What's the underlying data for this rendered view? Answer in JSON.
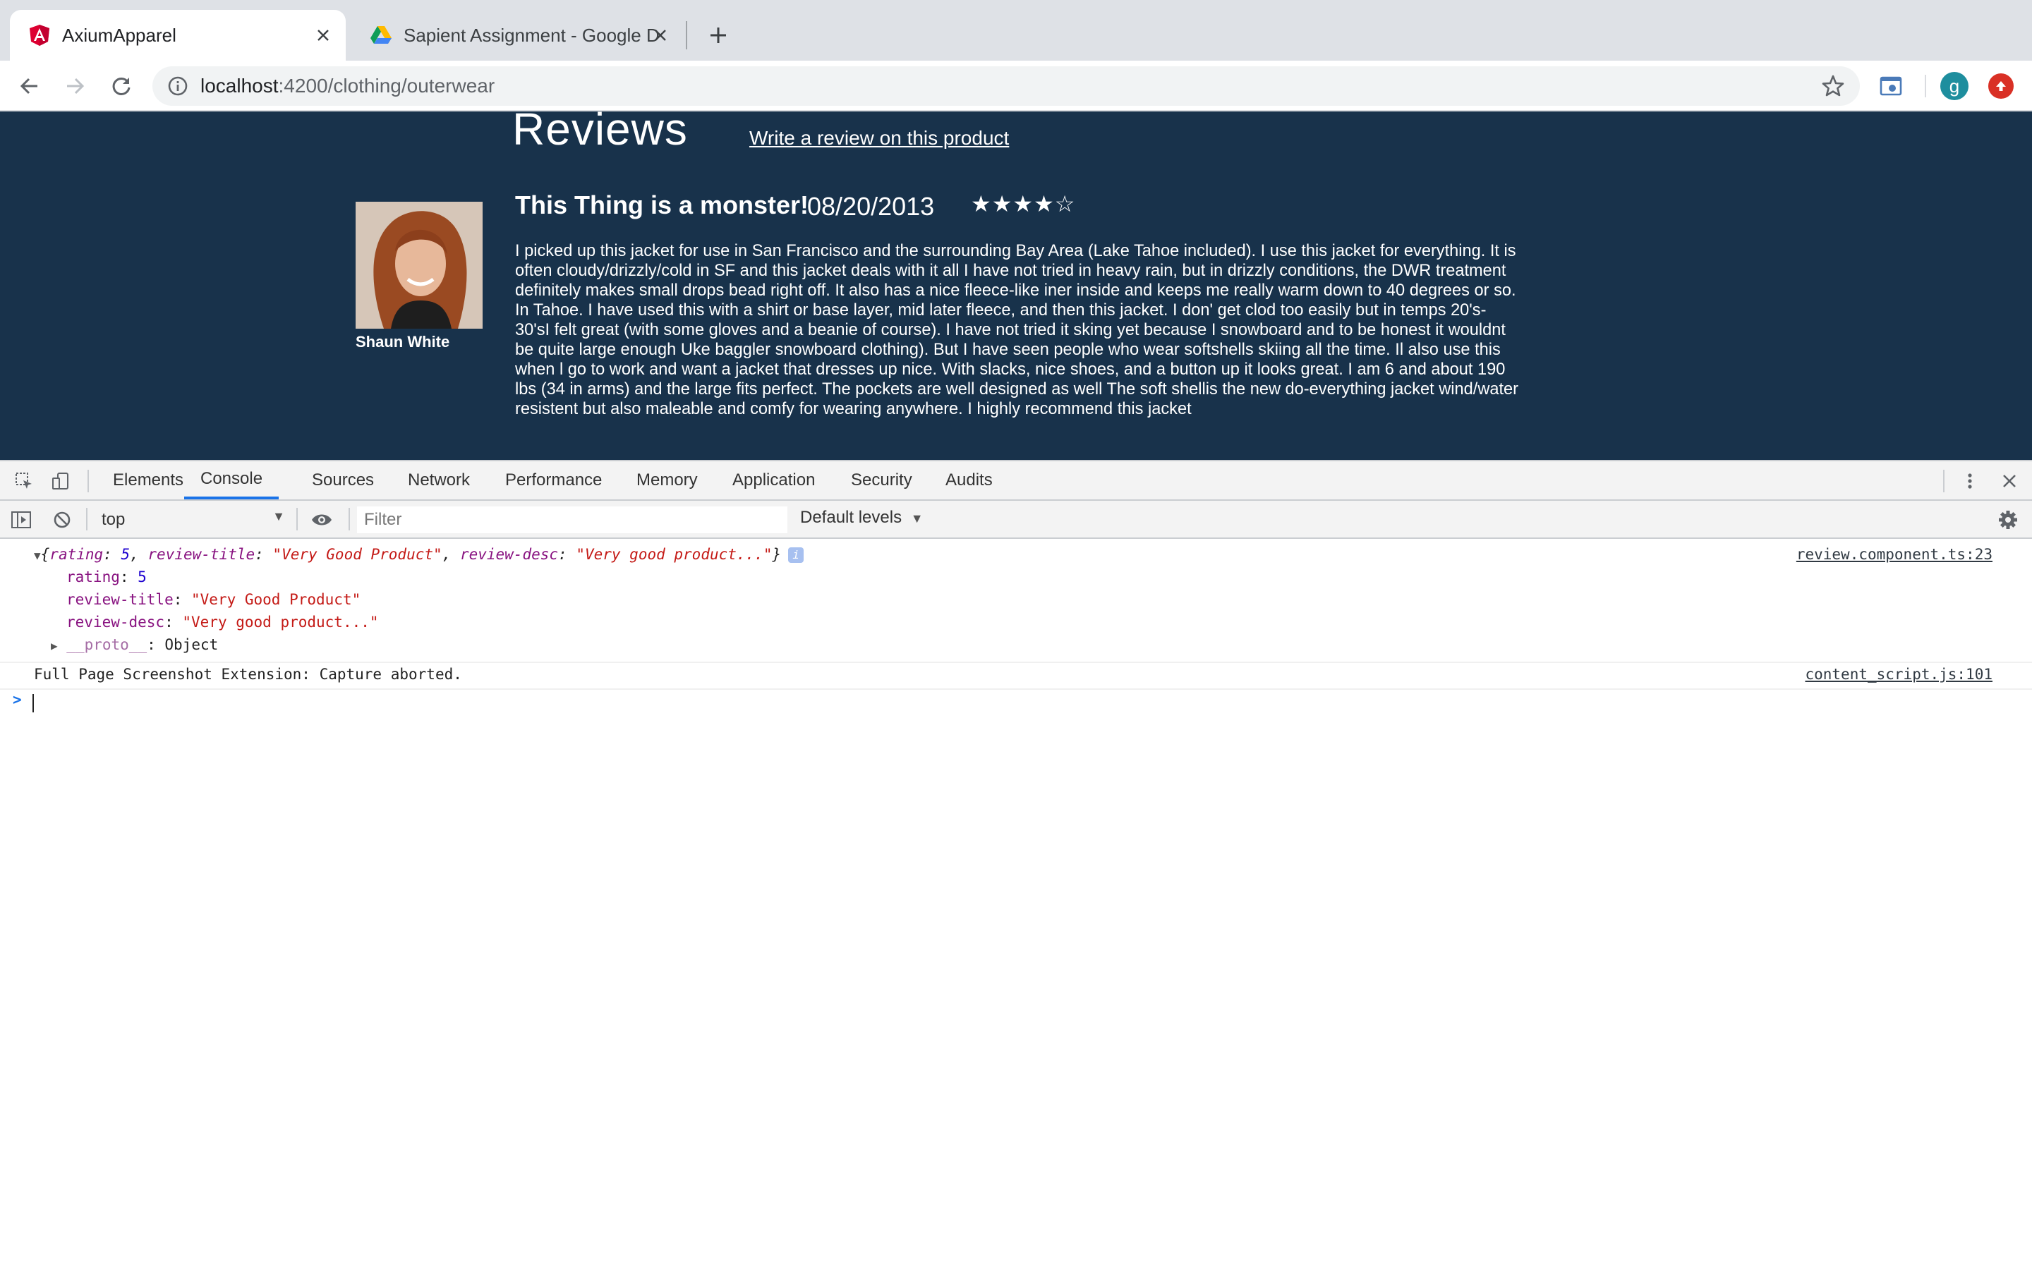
{
  "browser": {
    "tabs": [
      {
        "title": "AxiumApparel",
        "active": true,
        "icon": "angular-icon"
      },
      {
        "title": "Sapient Assignment - Google D",
        "active": false,
        "icon": "google-drive-icon"
      }
    ],
    "url_host": "localhost",
    "url_path": ":4200/clothing/outerwear",
    "profile_initial": "g"
  },
  "page": {
    "heading": "Reviews",
    "write_review_link": "Write a review on this product",
    "review": {
      "reviewer_name": "Shaun White",
      "title": "This Thing is a monster!",
      "date": "08/20/2013",
      "stars_display": "★★★★☆",
      "rating": 4,
      "rating_max": 5,
      "body": "I picked up this jacket for use in San Francisco and the surrounding Bay Area (Lake Tahoe included). I use this jacket for everything. It is often cloudy/drizzly/cold in SF and this jacket deals with it all I have not tried in heavy rain, but in drizzly conditions, the DWR treatment definitely makes small drops bead right off. It also has a nice fleece-like iner inside and keeps me really warm down to 40 degrees or so. In Tahoe. I have used this with a shirt or base layer, mid later fleece, and then this jacket. I don' get clod too easily but in temps 20's-30'sI felt great (with some gloves and a beanie of course). I have not tried it sking yet because I snowboard and to be honest it wouldnt be quite large enough Uke baggler snowboard clothing). But I have seen people who wear softshells skiing all the time. Il also use this when l go to work and want a jacket that dresses up nice. With slacks, nice shoes, and a button up it looks great. I am 6 and about 190 lbs (34 in arms) and the large fits perfect. The pockets are well designed as well The soft shellis the new do-everything jacket wind/water resistent but also maleable and comfy for wearing anywhere. I highly recommend this jacket"
    }
  },
  "devtools": {
    "tabs": [
      "Elements",
      "Console",
      "Sources",
      "Network",
      "Performance",
      "Memory",
      "Application",
      "Security",
      "Audits"
    ],
    "active_tab": "Console",
    "context": "top",
    "filter_placeholder": "Filter",
    "levels": "Default levels",
    "console": {
      "object_summary_prefix": "{",
      "object_summary": {
        "rating_key": "rating",
        "rating_val": "5",
        "title_key": "review-title",
        "title_val": "\"Very Good Product\"",
        "desc_key": "review-desc",
        "desc_val": "\"Very good product...\""
      },
      "props": [
        {
          "key": "rating",
          "value": "5",
          "type": "num"
        },
        {
          "key": "review-title",
          "value": "\"Very Good Product\"",
          "type": "str"
        },
        {
          "key": "review-desc",
          "value": "\"Very good product...\"",
          "type": "str"
        }
      ],
      "proto_key": "__proto__",
      "proto_val": "Object",
      "source_1": "review.component.ts:23",
      "message_2": "Full Page Screenshot Extension: Capture aborted.",
      "source_2": "content_script.js:101",
      "prompt": ">"
    }
  },
  "colors": {
    "page_bg": "#18324b",
    "devtools_accent": "#1a73e8",
    "console_key": "#881280",
    "console_string": "#c41a16",
    "console_number": "#1c00cf"
  }
}
